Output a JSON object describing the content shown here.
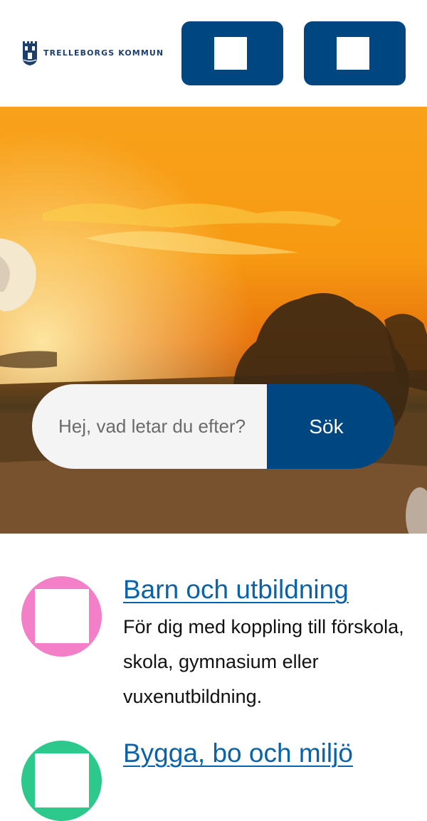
{
  "header": {
    "logo_text": "TRELLEBORGS KOMMUN",
    "logo_icon": "castle-crest-icon",
    "menu_button_icon": "menu-icon",
    "search_button_icon": "search-icon",
    "button_color": "#004680"
  },
  "hero": {
    "image": "sunset-over-fields",
    "search": {
      "placeholder": "Hej, vad letar du efter?",
      "value": "",
      "button_label": "Sök"
    }
  },
  "categories": [
    {
      "title": "Barn och utbildning",
      "description": "För dig med koppling till förskola, skola, gymnasium eller vuxenutbildning.",
      "icon_color": "#f27fc7",
      "icon": "category-icon"
    },
    {
      "title": "Bygga, bo och miljö",
      "description": "",
      "icon_color": "#2dc88b",
      "icon": "category-icon"
    }
  ]
}
